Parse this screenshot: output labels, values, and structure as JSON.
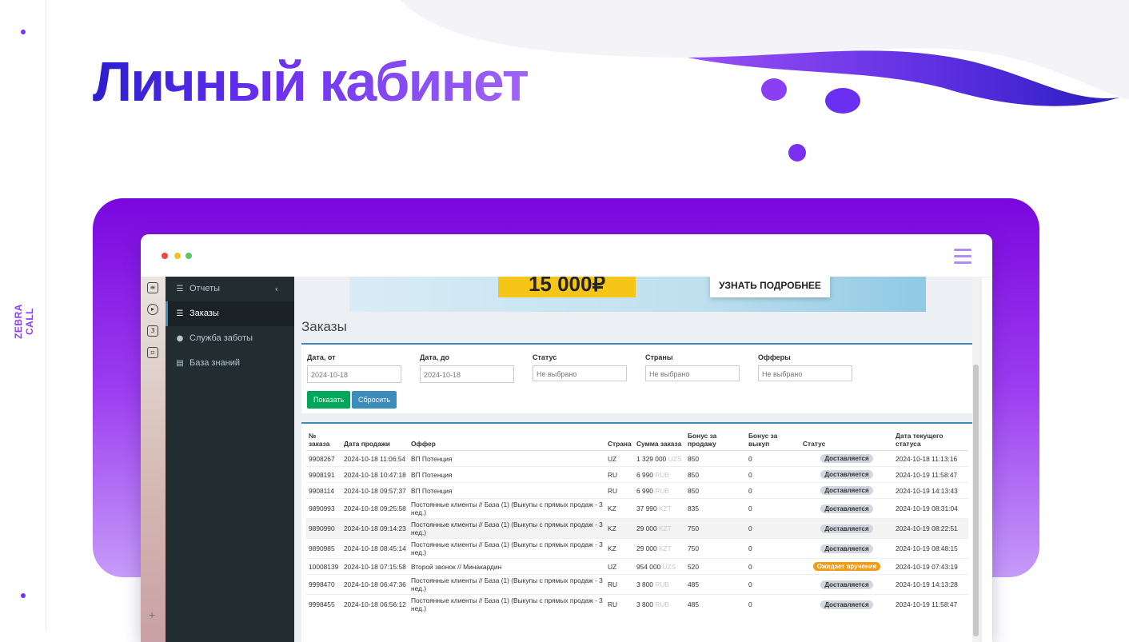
{
  "slide": {
    "title": "Личный кабинет",
    "brand_vertical": "ZEBRA CALL"
  },
  "sidebar": {
    "items": [
      {
        "label": "Отчеты",
        "icon": "list-icon",
        "chevron": "‹"
      },
      {
        "label": "Заказы",
        "icon": "list-icon",
        "active": true
      },
      {
        "label": "Служба заботы",
        "icon": "chat-icon"
      },
      {
        "label": "База знаний",
        "icon": "database-icon"
      }
    ]
  },
  "icon_strip": {
    "items": [
      "document-icon",
      "play-icon",
      "number-three-icon",
      "gallery-icon"
    ],
    "number_label": "3"
  },
  "banner": {
    "amount": "15 000₽",
    "button": "УЗНАТЬ ПОДРОБНЕЕ"
  },
  "page": {
    "heading": "Заказы"
  },
  "filters": {
    "date_from_label": "Дата, от",
    "date_from_value": "2024-10-18",
    "date_to_label": "Дата, до",
    "date_to_value": "2024-10-18",
    "status_label": "Статус",
    "status_value": "Не выбрано",
    "countries_label": "Страны",
    "countries_value": "Не выбрано",
    "offers_label": "Офферы",
    "offers_value": "Не выбрано",
    "show_button": "Показать",
    "reset_button": "Сбросить"
  },
  "table": {
    "headers": [
      "№ заказа",
      "Дата продажи",
      "Оффер",
      "Страна",
      "Сумма заказа",
      "Бонус за продажу",
      "Бонус за выкуп",
      "Статус",
      "Дата текущего статуса"
    ],
    "rows": [
      {
        "id": "9908267",
        "date": "2024-10-18 11:06:54",
        "offer": "ВП Потенция",
        "country": "UZ",
        "amount": "1 329 000",
        "currency": "UZS",
        "bonus_sale": "850",
        "bonus_buyout": "0",
        "status": "Доставляется",
        "status_date": "2024-10-18 11:13:16"
      },
      {
        "id": "9908191",
        "date": "2024-10-18 10:47:18",
        "offer": "ВП Потенция",
        "country": "RU",
        "amount": "6 990",
        "currency": "RUB",
        "bonus_sale": "850",
        "bonus_buyout": "0",
        "status": "Доставляется",
        "status_date": "2024-10-19 11:58:47"
      },
      {
        "id": "9908114",
        "date": "2024-10-18 09:57:37",
        "offer": "ВП Потенция",
        "country": "RU",
        "amount": "6 990",
        "currency": "RUB",
        "bonus_sale": "850",
        "bonus_buyout": "0",
        "status": "Доставляется",
        "status_date": "2024-10-19 14:13:43"
      },
      {
        "id": "9890993",
        "date": "2024-10-18 09:25:58",
        "offer": "Постоянные клиенты // База (1) (Выкупы с прямых продаж - 3 нед.)",
        "country": "KZ",
        "amount": "37 990",
        "currency": "KZT",
        "bonus_sale": "835",
        "bonus_buyout": "0",
        "status": "Доставляется",
        "status_date": "2024-10-19 08:31:04"
      },
      {
        "id": "9890990",
        "date": "2024-10-18 09:14:23",
        "offer": "Постоянные клиенты // База (1) (Выкупы с прямых продаж - 3 нед.)",
        "country": "KZ",
        "amount": "29 000",
        "currency": "KZT",
        "bonus_sale": "750",
        "bonus_buyout": "0",
        "status": "Доставляется",
        "status_date": "2024-10-19 08:22:51"
      },
      {
        "id": "9890985",
        "date": "2024-10-18 08:45:14",
        "offer": "Постоянные клиенты // База (1) (Выкупы с прямых продаж - 3 нед.)",
        "country": "KZ",
        "amount": "29 000",
        "currency": "KZT",
        "bonus_sale": "750",
        "bonus_buyout": "0",
        "status": "Доставляется",
        "status_date": "2024-10-19 08:48:15"
      },
      {
        "id": "10008139",
        "date": "2024-10-18 07:15:58",
        "offer": "Второй звонок // Минакардин",
        "country": "UZ",
        "amount": "954 000",
        "currency": "UZS",
        "bonus_sale": "520",
        "bonus_buyout": "0",
        "status": "Ожидает вручения",
        "status_date": "2024-10-19 07:43:19"
      },
      {
        "id": "9998470",
        "date": "2024-10-18 06:47:36",
        "offer": "Постоянные клиенты // База (1) (Выкупы с прямых продаж - 3 нед.)",
        "country": "RU",
        "amount": "3 800",
        "currency": "RUB",
        "bonus_sale": "485",
        "bonus_buyout": "0",
        "status": "Доставляется",
        "status_date": "2024-10-19 14:13:28"
      },
      {
        "id": "9998455",
        "date": "2024-10-18 06:56:12",
        "offer": "Постоянные клиенты // База (1) (Выкупы с прямых продаж - 3 нед.)",
        "country": "RU",
        "amount": "3 800",
        "currency": "RUB",
        "bonus_sale": "485",
        "bonus_buyout": "0",
        "status": "Доставляется",
        "status_date": "2024-10-19 11:58:47"
      }
    ]
  },
  "colors": {
    "accent": "#7b2ff2",
    "panel_top": "#7a07de",
    "sidebar_bg": "#222d32",
    "box_border": "#3c8dbc",
    "btn_show": "#00a65a",
    "btn_reset": "#3c8dbc",
    "status_delivering_bg": "#d2d6de",
    "status_awaiting_bg": "#f39c12"
  }
}
